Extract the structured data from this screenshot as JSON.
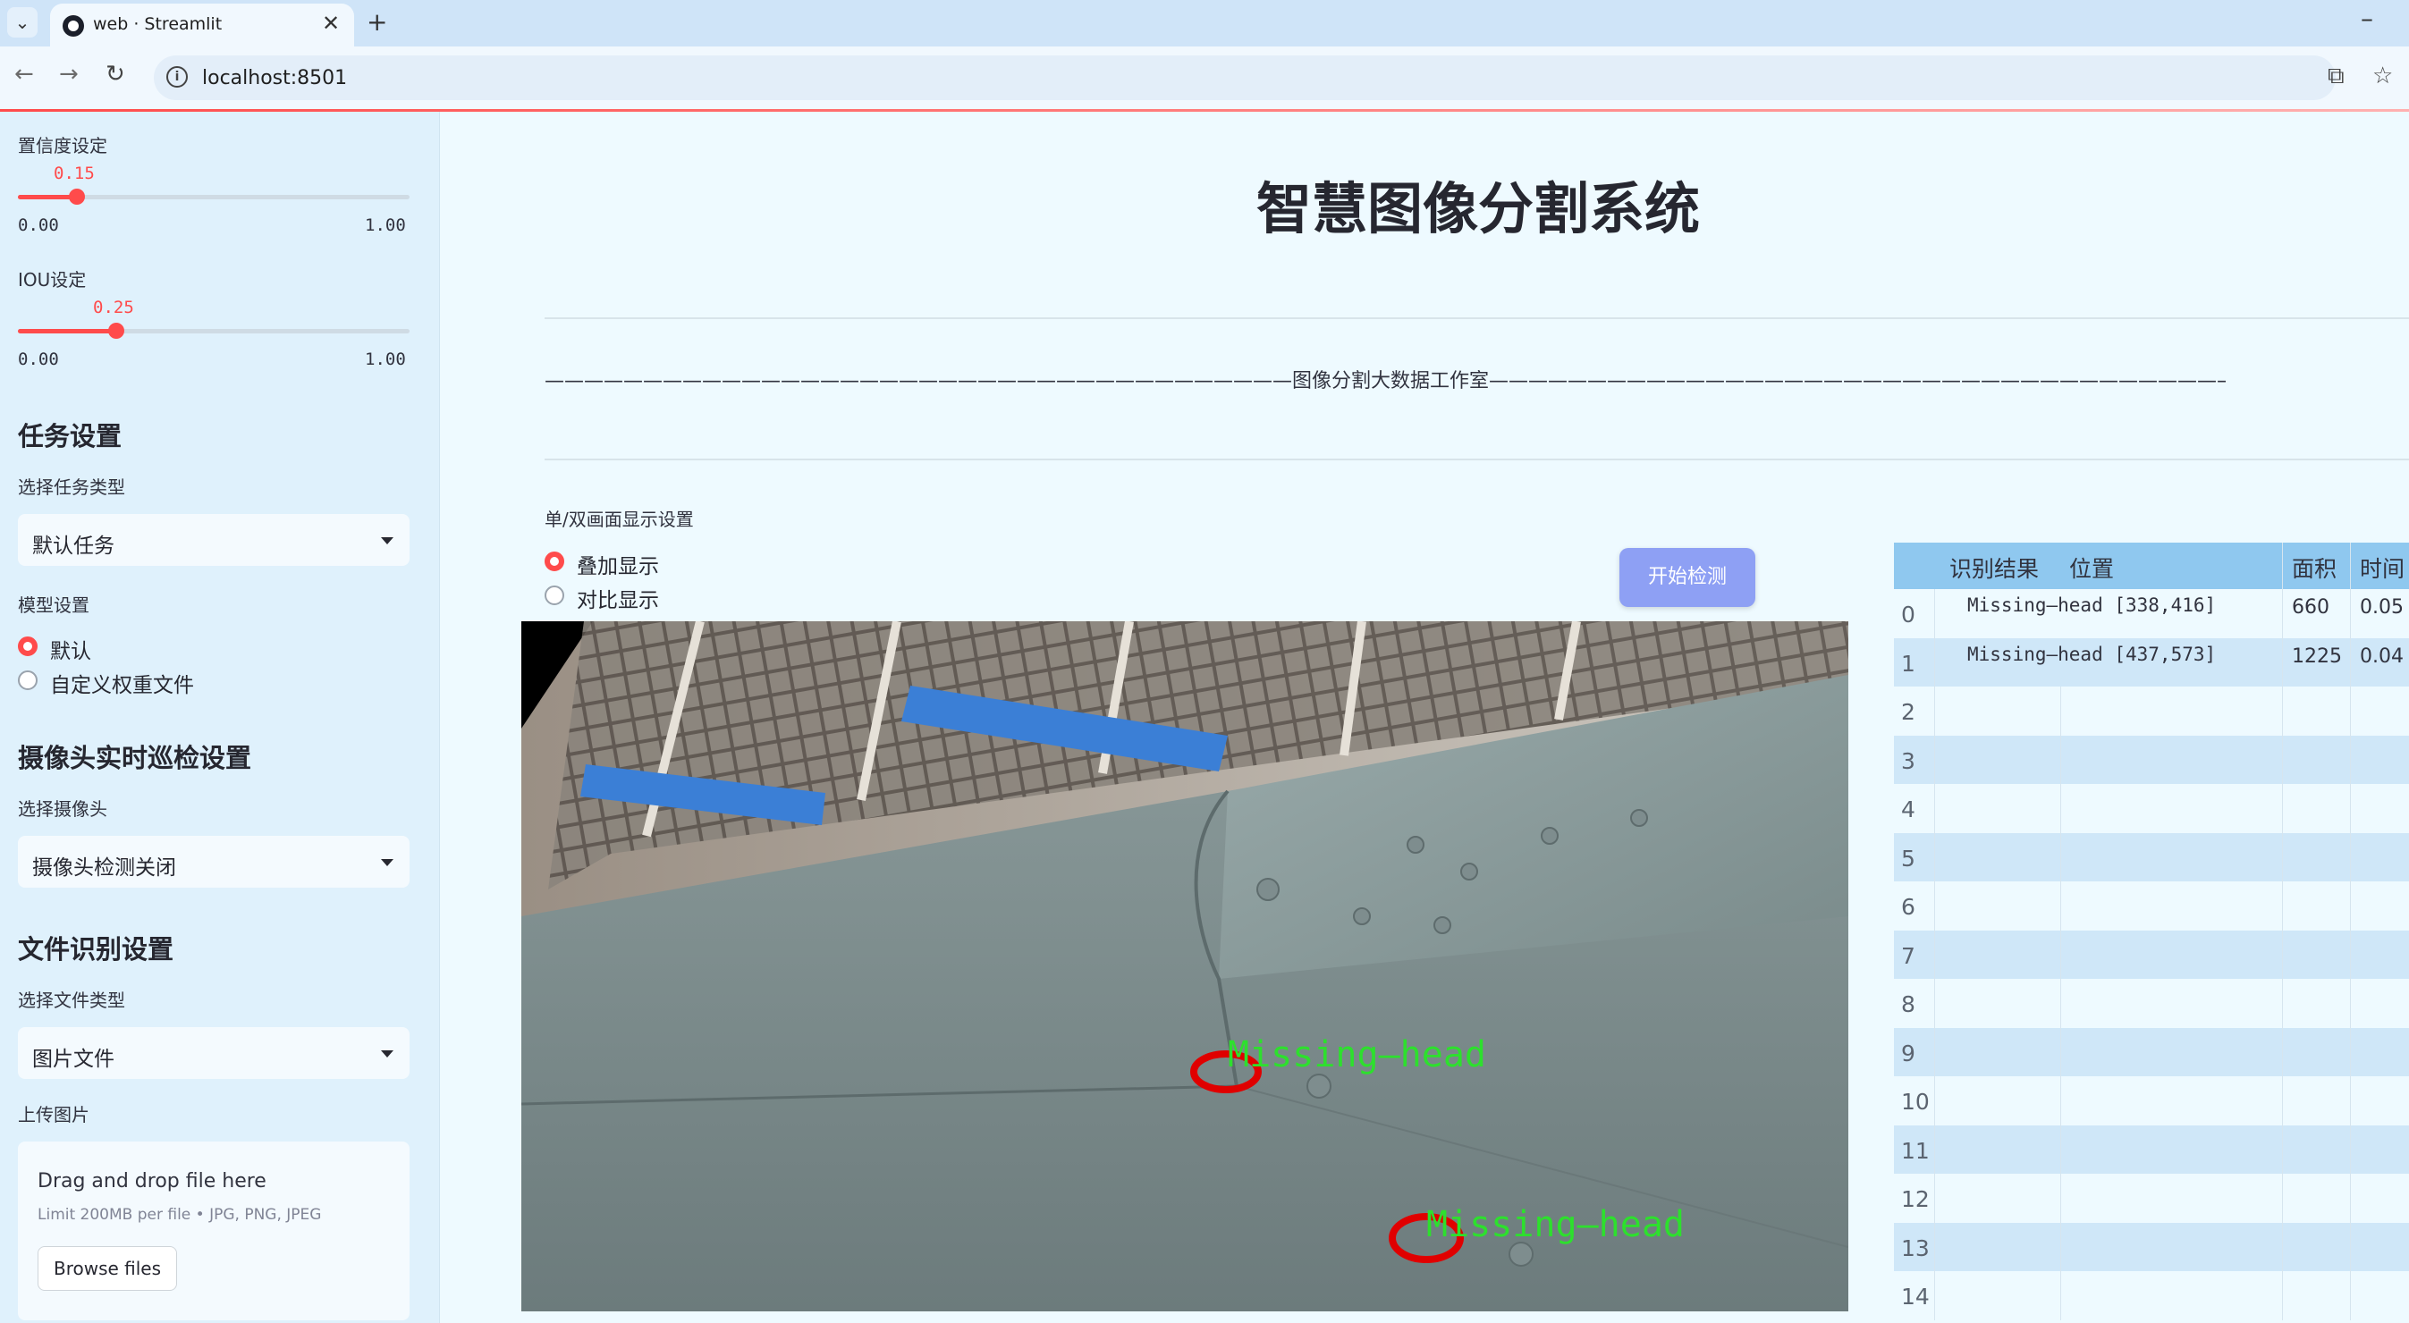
{
  "browser": {
    "tab_title": "web · Streamlit",
    "url": "localhost:8501"
  },
  "sidebar": {
    "confidence": {
      "label": "置信度设定",
      "value": "0.15",
      "min": "0.00",
      "max": "1.00",
      "fraction": 0.15
    },
    "iou": {
      "label": "IOU设定",
      "value": "0.25",
      "min": "0.00",
      "max": "1.00",
      "fraction": 0.25
    },
    "task_section": "任务设置",
    "task_type_label": "选择任务类型",
    "task_type_value": "默认任务",
    "model_label": "模型设置",
    "model_options": [
      "默认",
      "自定义权重文件"
    ],
    "model_selected": 0,
    "camera_section": "摄像头实时巡检设置",
    "camera_label": "选择摄像头",
    "camera_value": "摄像头检测关闭",
    "file_section": "文件识别设置",
    "file_type_label": "选择文件类型",
    "file_type_value": "图片文件",
    "upload_label": "上传图片",
    "upload_drag": "Drag and drop file here",
    "upload_limit": "Limit 200MB per file • JPG, PNG, JPEG",
    "browse_label": "Browse files"
  },
  "main": {
    "title": "智慧图像分割系统",
    "subtitle": "——————————————————————————————————————图像分割大数据工作室———————————————————————————————————————",
    "display_label": "单/双画面显示设置",
    "display_options": [
      "叠加显示",
      "对比显示"
    ],
    "display_selected": 0,
    "detect_button": "开始检测",
    "detections": [
      "Missing—head",
      "Missing—head"
    ]
  },
  "table": {
    "headers": [
      "识别结果",
      "位置",
      "面积",
      "时间"
    ],
    "rows": [
      {
        "idx": "0",
        "text": "Missing—head [338,416]",
        "area": "660",
        "time": "0.05"
      },
      {
        "idx": "1",
        "text": "Missing—head [437,573]",
        "area": "1225",
        "time": "0.04"
      }
    ],
    "empty_indices": [
      "2",
      "3",
      "4",
      "5",
      "6",
      "7",
      "8",
      "9",
      "10",
      "11",
      "12",
      "13",
      "14"
    ]
  }
}
